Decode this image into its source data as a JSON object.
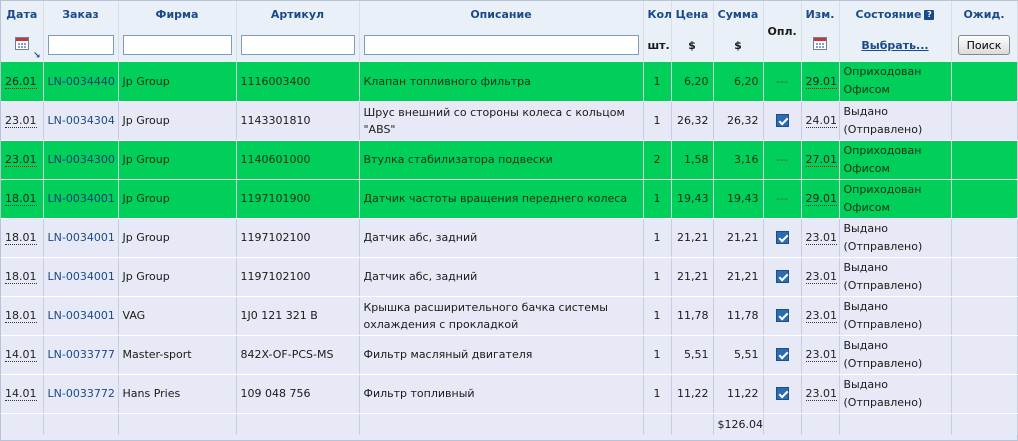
{
  "headers": {
    "date": "Дата",
    "order": "Заказ",
    "firm": "Фирма",
    "article": "Артикул",
    "description": "Описание",
    "qty": "Кол",
    "price": "Цена",
    "sum": "Сумма",
    "paid": "Опл.",
    "changed": "Изм.",
    "state": "Состояние",
    "waiting": "Ожид."
  },
  "subheaders": {
    "qty_unit": "шт.",
    "price_unit": "$",
    "sum_unit": "$",
    "choose_link": "Выбрать...",
    "search_button": "Поиск",
    "help_icon_text": "?"
  },
  "filters": {
    "order": "",
    "firm": "",
    "article": "",
    "description": ""
  },
  "rows": [
    {
      "date": "26.01",
      "order": "LN-0034440",
      "firm": "Jp Group",
      "article": "1116003400",
      "description": "Клапан топливного фильтра",
      "qty": "1",
      "price": "6,20",
      "sum": "6,20",
      "paid": "---",
      "paid_checked": false,
      "changed": "29.01",
      "state": "Оприходован Офисом",
      "color": "green"
    },
    {
      "date": "23.01",
      "order": "LN-0034304",
      "firm": "Jp Group",
      "article": "1143301810",
      "description": "Шрус внешний со стороны колеса с кольцом \"ABS\"",
      "qty": "1",
      "price": "26,32",
      "sum": "26,32",
      "paid": "",
      "paid_checked": true,
      "changed": "24.01",
      "state": "Выдано (Отправлено)",
      "color": "lavender"
    },
    {
      "date": "23.01",
      "order": "LN-0034300",
      "firm": "Jp Group",
      "article": "1140601000",
      "description": "Втулка стабилизатора подвески",
      "qty": "2",
      "price": "1,58",
      "sum": "3,16",
      "paid": "---",
      "paid_checked": false,
      "changed": "27.01",
      "state": "Оприходован Офисом",
      "color": "green"
    },
    {
      "date": "18.01",
      "order": "LN-0034001",
      "firm": "Jp Group",
      "article": "1197101900",
      "description": "Датчик частоты вращения переднего колеса",
      "qty": "1",
      "price": "19,43",
      "sum": "19,43",
      "paid": "---",
      "paid_checked": false,
      "changed": "29.01",
      "state": "Оприходован Офисом",
      "color": "green"
    },
    {
      "date": "18.01",
      "order": "LN-0034001",
      "firm": "Jp Group",
      "article": "1197102100",
      "description": "Датчик абс, задний",
      "qty": "1",
      "price": "21,21",
      "sum": "21,21",
      "paid": "",
      "paid_checked": true,
      "changed": "23.01",
      "state": "Выдано (Отправлено)",
      "color": "lavender"
    },
    {
      "date": "18.01",
      "order": "LN-0034001",
      "firm": "Jp Group",
      "article": "1197102100",
      "description": "Датчик абс, задний",
      "qty": "1",
      "price": "21,21",
      "sum": "21,21",
      "paid": "",
      "paid_checked": true,
      "changed": "23.01",
      "state": "Выдано (Отправлено)",
      "color": "lavender"
    },
    {
      "date": "18.01",
      "order": "LN-0034001",
      "firm": "VAG",
      "article": "1J0 121 321 B",
      "description": "Крышка расширительного бачка системы охлаждения с прокладкой",
      "qty": "1",
      "price": "11,78",
      "sum": "11,78",
      "paid": "",
      "paid_checked": true,
      "changed": "23.01",
      "state": "Выдано (Отправлено)",
      "color": "lavender"
    },
    {
      "date": "14.01",
      "order": "LN-0033777",
      "firm": "Master-sport",
      "article": "842X-OF-PCS-MS",
      "description": "Фильтр масляный двигателя",
      "qty": "1",
      "price": "5,51",
      "sum": "5,51",
      "paid": "",
      "paid_checked": true,
      "changed": "23.01",
      "state": "Выдано (Отправлено)",
      "color": "lavender"
    },
    {
      "date": "14.01",
      "order": "LN-0033772",
      "firm": "Hans Pries",
      "article": "109 048 756",
      "description": "Фильтр топливный",
      "qty": "1",
      "price": "11,22",
      "sum": "11,22",
      "paid": "",
      "paid_checked": true,
      "changed": "23.01",
      "state": "Выдано (Отправлено)",
      "color": "lavender"
    }
  ],
  "total": {
    "sum": "$126.04"
  },
  "colors": {
    "green_row": "#00d05a",
    "lavender_row": "#e7eaf6",
    "header_bg": "#eaf0f7",
    "header_text": "#1a4a8a"
  }
}
